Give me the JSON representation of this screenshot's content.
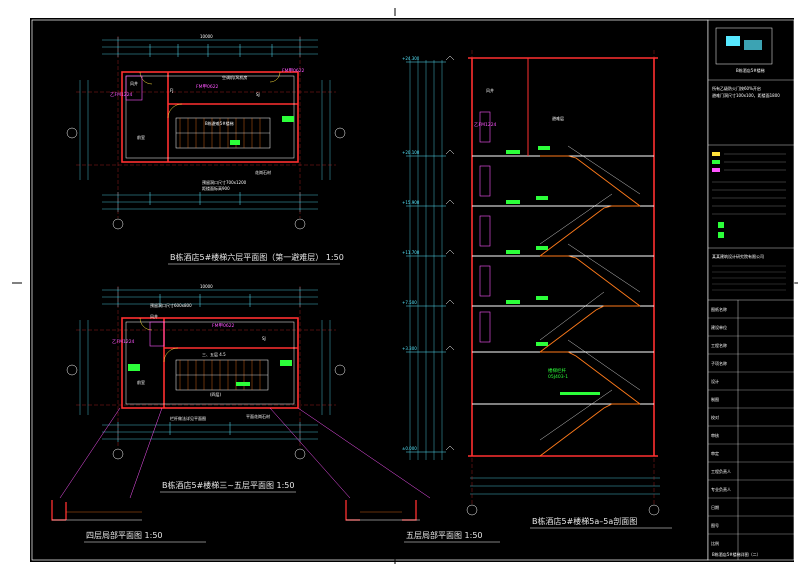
{
  "colors": {
    "background": "#000000",
    "frame": "#ffffff",
    "wall": "#ff3030",
    "dimension": "#56e8ff",
    "annotation": "#2cff3a",
    "stair": "#ff7a1a",
    "magenta": "#ff55ff",
    "yellow": "#ffe23b"
  },
  "titles": {
    "plan_sixth": "B栋酒店5#楼梯六层平面图（第一避难层）  1:50",
    "plan_three_five": "B栋酒店5#楼梯三~五层平面图  1:50",
    "detail_fourth": "四层局部平面图  1:50",
    "detail_fifth": "五层局部平面图  1:50",
    "section": "B栋酒店5#楼梯5a–5a剖面图"
  },
  "plan_top": {
    "dim_total": "10000",
    "door_fm": "FM甲0622",
    "door_fm2": "FM甲0622",
    "door_zfm": "乙FM1224",
    "room_shaft": "风井",
    "room_front": "前室",
    "label_refuge": "B栋避难5#楼梯",
    "label_ac": "空调机/风机房",
    "label_sj": "SJ",
    "label_fj": "FJ",
    "note_stone": "花岗石材",
    "note_hole": "预留洞口尺寸700x1200",
    "note_hole2": "距楼面标高900"
  },
  "plan_mid": {
    "dim_total": "10000",
    "door_fm": "FM甲0622",
    "door_zfm": "乙FM1224",
    "room_shaft": "风井",
    "room_front": "前室",
    "label_sj": "SJ",
    "level_a": "三、五层 4.5",
    "level_b": "(四层)",
    "note_hole": "预留洞口尺寸600x800",
    "note_railing": "栏杆做法详见平面图",
    "note_stone": "平面花岗石材"
  },
  "section": {
    "room_shaft": "风井",
    "room_refuge": "避难层",
    "door_zfm": "乙FM1224",
    "note_rail": "楼梯栏杆",
    "note_rail2": "05J403-1"
  },
  "title_block": {
    "project_name": "B栋酒店5#楼梯",
    "note_lines": [
      "所有乙级防火门按60%开启",
      "避难门洞尺寸100x100，距楼面1800"
    ],
    "company": "某某建筑设计研究院有限公司",
    "rows": [
      "图纸名称",
      "建设单位",
      "工程名称",
      "子项名称",
      "设计",
      "制图",
      "校对",
      "审核",
      "审定",
      "工程负责人",
      "专业负责人",
      "日期",
      "图号",
      "比例"
    ],
    "sheet_number": "B栋酒店5#楼梯详图（二）"
  },
  "elevations": [
    "+24.300",
    "+20.100",
    "+15.900",
    "+11.700",
    "+7.500",
    "+3.300",
    "±0.000"
  ]
}
